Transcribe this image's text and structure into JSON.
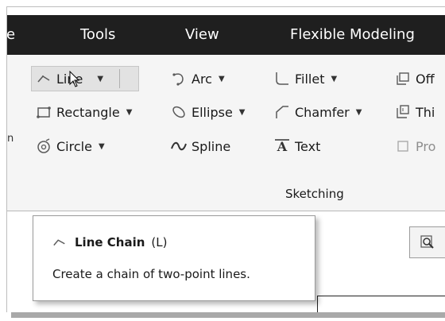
{
  "menubar": {
    "items": [
      "e",
      "Tools",
      "View",
      "Flexible Modeling"
    ]
  },
  "ribbon": {
    "left_fragment": "n",
    "group_label": "Sketching",
    "col1": {
      "line": "Line",
      "rectangle": "Rectangle",
      "circle": "Circle"
    },
    "col2": {
      "arc": "Arc",
      "ellipse": "Ellipse",
      "spline": "Spline"
    },
    "col3": {
      "fillet": "Fillet",
      "chamfer": "Chamfer",
      "text": "Text"
    },
    "col4": {
      "offset": "Off",
      "thicken": "Thi",
      "project": "Pro"
    }
  },
  "tooltip": {
    "title": "Line Chain",
    "shortcut": "(L)",
    "description": "Create a chain of two-point lines."
  },
  "colors": {
    "menubar_bg": "#1f1f1f",
    "ribbon_bg": "#f5f5f5",
    "tool_icon_gray": "#5a5a5a"
  },
  "icons": [
    "line-icon",
    "rectangle-icon",
    "circle-icon",
    "arc-icon",
    "ellipse-icon",
    "spline-icon",
    "fillet-icon",
    "chamfer-icon",
    "text-icon",
    "offset-icon",
    "thicken-icon",
    "project-icon",
    "search-icon",
    "mouse-pointer-icon"
  ]
}
